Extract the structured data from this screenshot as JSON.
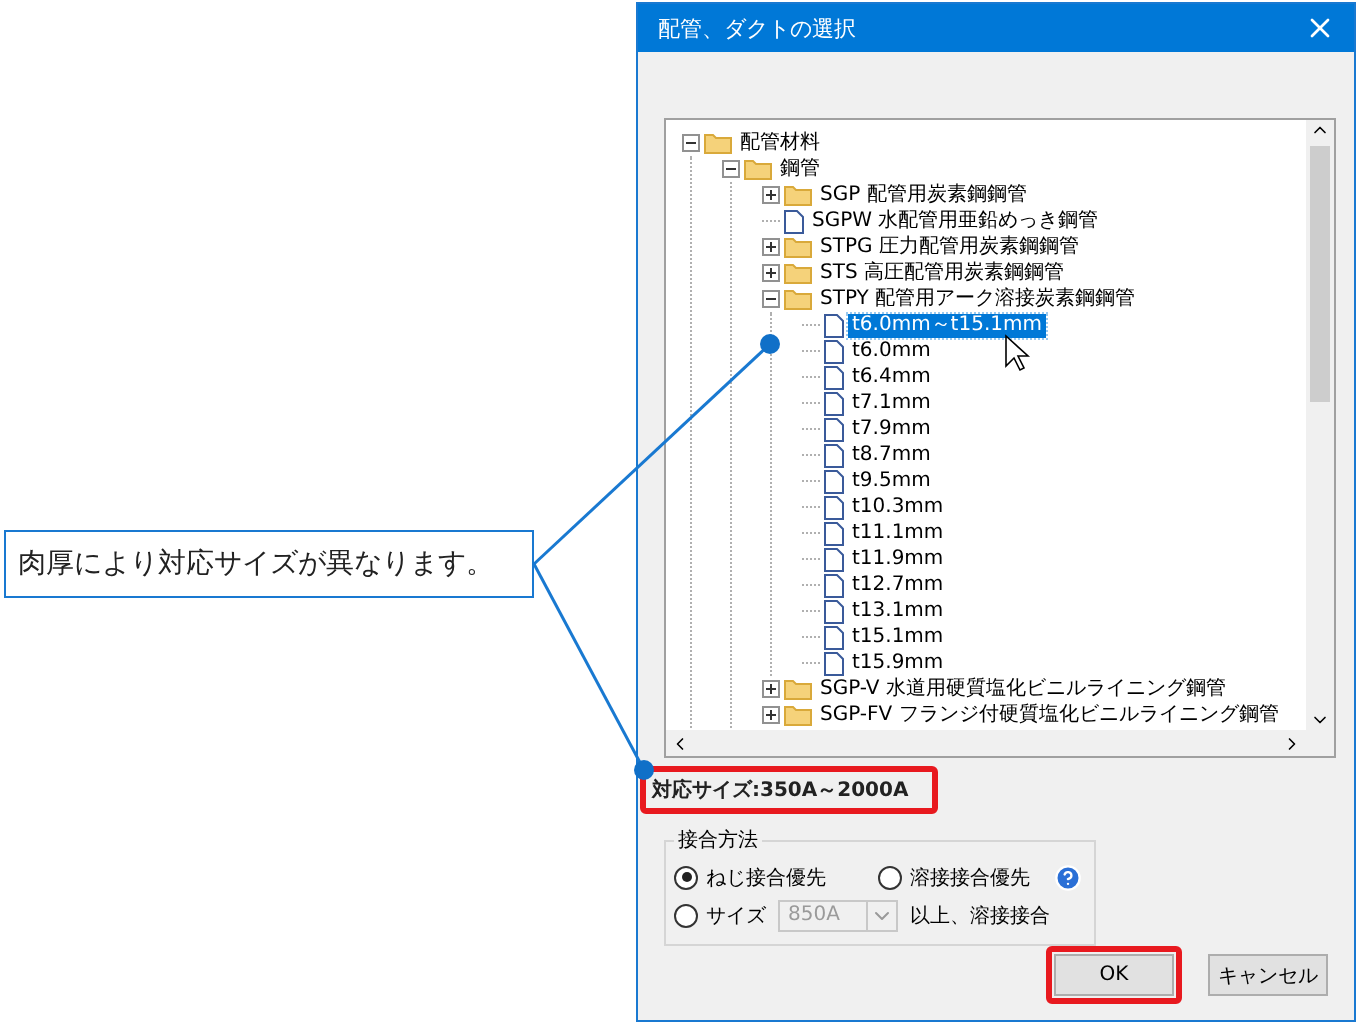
{
  "callout": {
    "text": "肉厚により対応サイズが異なります。"
  },
  "dialog": {
    "title": "配管、ダクトの選択",
    "tree": [
      {
        "label": "配管材料",
        "kind": "folder",
        "expanded": true,
        "selected": false,
        "children": [
          {
            "label": "鋼管",
            "kind": "folder",
            "expanded": true,
            "selected": false,
            "children": [
              {
                "label": "SGP 配管用炭素鋼鋼管",
                "kind": "folder",
                "expanded": false,
                "selected": false
              },
              {
                "label": "SGPW 水配管用亜鉛めっき鋼管",
                "kind": "file",
                "selected": false
              },
              {
                "label": "STPG 圧力配管用炭素鋼鋼管",
                "kind": "folder",
                "expanded": false,
                "selected": false
              },
              {
                "label": "STS 高圧配管用炭素鋼鋼管",
                "kind": "folder",
                "expanded": false,
                "selected": false
              },
              {
                "label": "STPY 配管用アーク溶接炭素鋼鋼管",
                "kind": "folder",
                "expanded": true,
                "selected": false,
                "children": [
                  {
                    "label": "t6.0mm～t15.1mm",
                    "kind": "file",
                    "selected": true
                  },
                  {
                    "label": "t6.0mm",
                    "kind": "file",
                    "selected": false
                  },
                  {
                    "label": "t6.4mm",
                    "kind": "file",
                    "selected": false
                  },
                  {
                    "label": "t7.1mm",
                    "kind": "file",
                    "selected": false
                  },
                  {
                    "label": "t7.9mm",
                    "kind": "file",
                    "selected": false
                  },
                  {
                    "label": "t8.7mm",
                    "kind": "file",
                    "selected": false
                  },
                  {
                    "label": "t9.5mm",
                    "kind": "file",
                    "selected": false
                  },
                  {
                    "label": "t10.3mm",
                    "kind": "file",
                    "selected": false
                  },
                  {
                    "label": "t11.1mm",
                    "kind": "file",
                    "selected": false
                  },
                  {
                    "label": "t11.9mm",
                    "kind": "file",
                    "selected": false
                  },
                  {
                    "label": "t12.7mm",
                    "kind": "file",
                    "selected": false
                  },
                  {
                    "label": "t13.1mm",
                    "kind": "file",
                    "selected": false
                  },
                  {
                    "label": "t15.1mm",
                    "kind": "file",
                    "selected": false
                  },
                  {
                    "label": "t15.9mm",
                    "kind": "file",
                    "selected": false
                  }
                ]
              },
              {
                "label": "SGP-V 水道用硬質塩化ビニルライニング鋼管",
                "kind": "folder",
                "expanded": false,
                "selected": false
              },
              {
                "label": "SGP-FV フランジ付硬質塩化ビニルライニング鋼管",
                "kind": "folder",
                "expanded": false,
                "selected": false
              }
            ]
          }
        ]
      }
    ],
    "size_info": "対応サイズ:350A～2000A",
    "joint_group": {
      "title": "接合方法",
      "options": [
        {
          "label": "ねじ接合優先",
          "selected": true
        },
        {
          "label": "溶接接合優先",
          "selected": false
        },
        {
          "label": "サイズ",
          "selected": false
        }
      ],
      "size_select": {
        "value": "850A",
        "disabled": true
      },
      "suffix": "以上、溶接接合"
    },
    "buttons": [
      {
        "label": "OK",
        "kind": "primary"
      },
      {
        "label": "キャンセル",
        "kind": "normal"
      }
    ]
  }
}
